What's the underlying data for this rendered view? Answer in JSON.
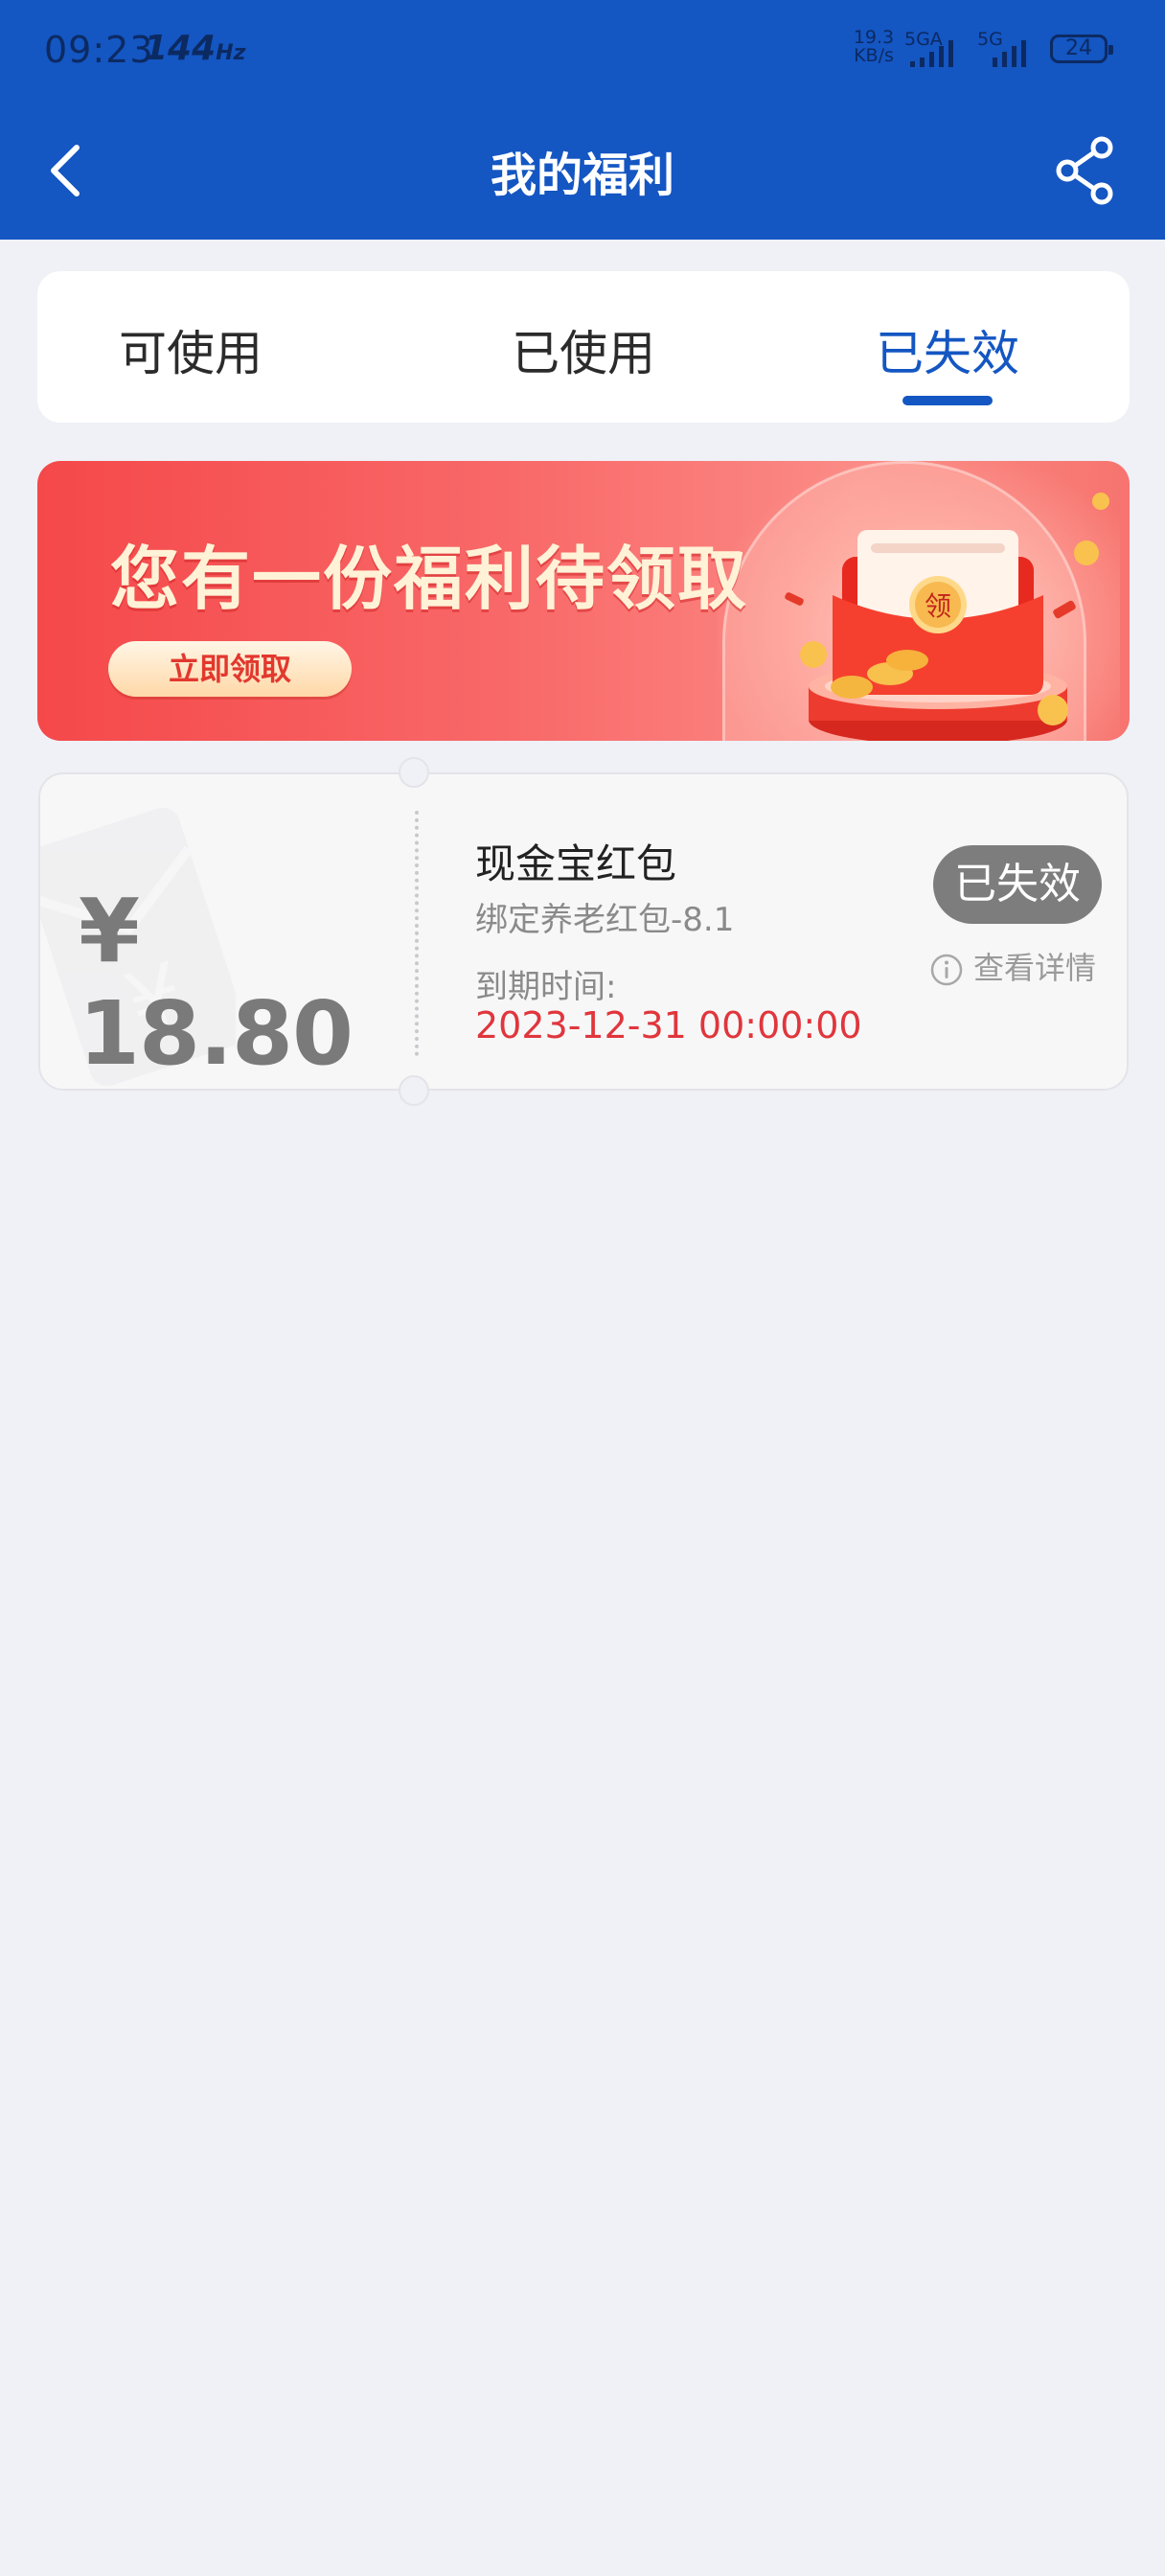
{
  "status_bar": {
    "time": "09:23",
    "refresh_rate": "144",
    "refresh_unit": "Hz",
    "net_speed_value": "19.3",
    "net_speed_unit": "KB/s",
    "sim1_label": "5GA",
    "sim2_label": "5G",
    "battery": "24"
  },
  "header": {
    "title": "我的福利",
    "back_icon": "chevron-left-icon",
    "share_icon": "share-icon",
    "color": "#1456c2"
  },
  "tabs": [
    {
      "label": "可使用",
      "active": false
    },
    {
      "label": "已使用",
      "active": false
    },
    {
      "label": "已失效",
      "active": true
    }
  ],
  "banner": {
    "title": "您有一份福利待领取",
    "button_label": "立即领取",
    "envelope_char": "领"
  },
  "coupon": {
    "currency": "¥",
    "amount": "18.80",
    "name": "现金宝红包",
    "subtitle": "绑定养老红包-8.1",
    "expire_label": "到期时间:",
    "expire_date": "2023-12-31 00:00:00",
    "status_badge": "已失效",
    "detail_label": "查看详情"
  }
}
